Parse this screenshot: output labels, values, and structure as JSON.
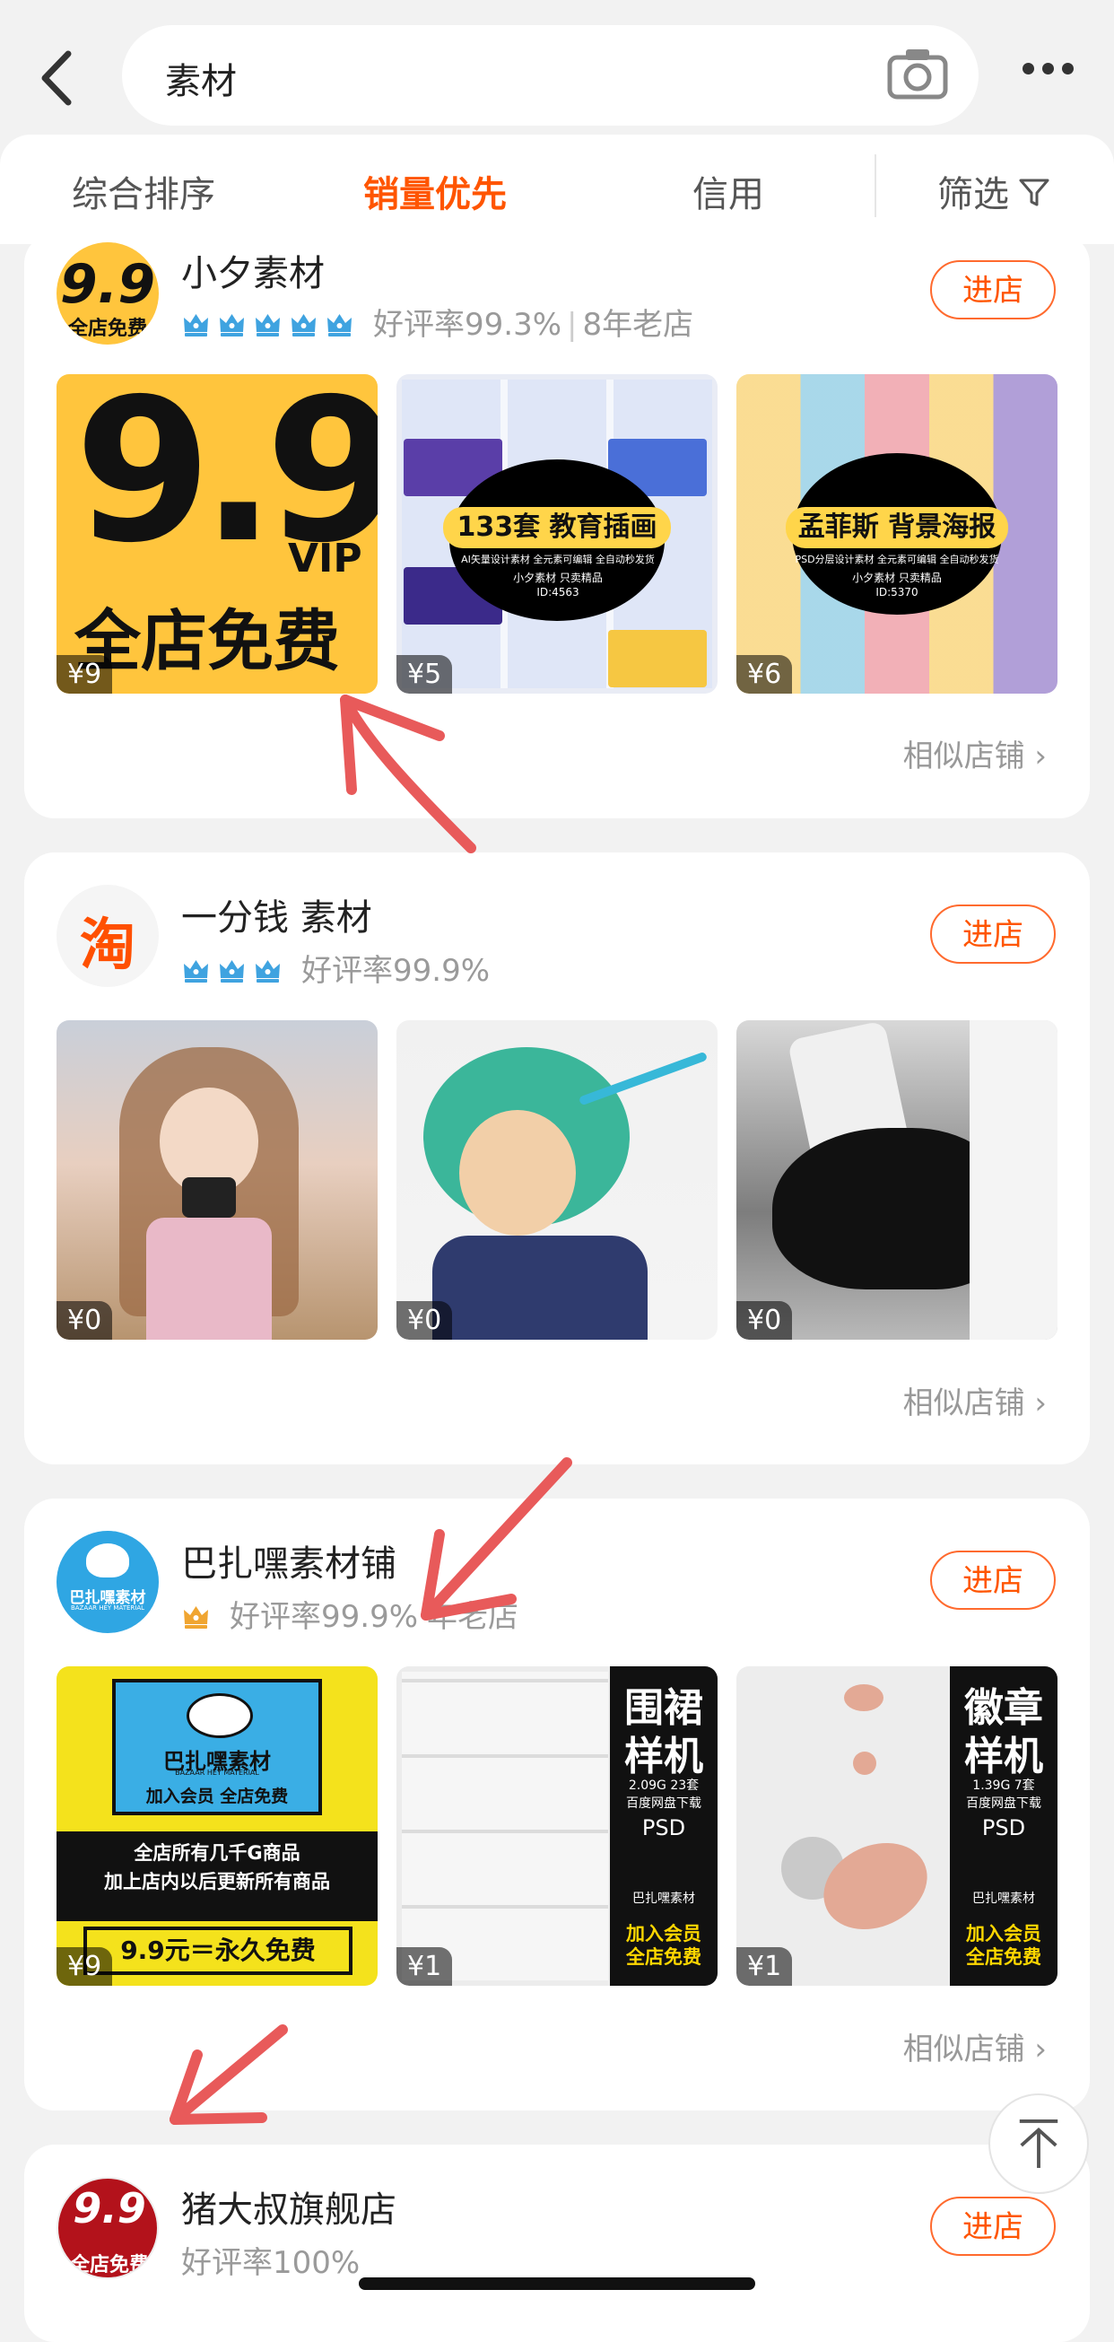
{
  "search": {
    "query": "素材"
  },
  "sort_tabs": [
    "综合排序",
    "销量优先",
    "信用",
    "筛选"
  ],
  "active_tab": "销量优先",
  "colors": {
    "accent": "#ff5500",
    "arrow": "#e85a5a",
    "crown": "#3fa3e0"
  },
  "shops": [
    {
      "name": "小夕素材",
      "rating": "好评率99.3%",
      "extra": "8年老店",
      "crowns": 5,
      "enter": "进店",
      "similar": "相似店铺",
      "logo_text": "9.9",
      "logo_sub": "全店免费",
      "products": [
        {
          "price": "¥9",
          "title": "9.9",
          "tag": "VIP",
          "subtitle": "全店免费"
        },
        {
          "price": "¥5",
          "title": "133套 教育插画",
          "subtitle": "AI矢量设计素材  全元素可编辑 全自动秒发货",
          "footer": "小夕素材 只卖精品",
          "id": "ID:4563"
        },
        {
          "price": "¥6",
          "title": "孟菲斯 背景海报",
          "subtitle": "PSD分层设计素材  全元素可编辑 全自动秒发货",
          "footer": "小夕素材 只卖精品",
          "id": "ID:5370"
        }
      ]
    },
    {
      "name": "一分钱 素材",
      "rating": "好评率99.9%",
      "crowns": 3,
      "enter": "进店",
      "similar": "相似店铺",
      "logo_text": "淘",
      "products": [
        {
          "price": "¥0"
        },
        {
          "price": "¥0"
        },
        {
          "price": "¥0"
        }
      ]
    },
    {
      "name": "巴扎嘿素材铺",
      "rating": "好评率99.9%",
      "extra": "年老店",
      "crowns": 1,
      "enter": "进店",
      "similar": "相似店铺",
      "logo_text": "巴扎嘿素材",
      "logo_sub": "BAZAAR HEY MATERIAL",
      "products": [
        {
          "price": "¥9",
          "brand": "巴扎嘿素材",
          "brand_en": "BAZAAR HEY MATERIAL",
          "member": "加入会员  全店免费",
          "line1": "全店所有几千G商品",
          "line2": "加上店内以后更新所有商品",
          "offer": "9.9元＝永久免费"
        },
        {
          "price": "¥1",
          "title1": "围裙",
          "title2": "样机",
          "size": "2.09G  23套",
          "note": "百度网盘下载",
          "fmt": "PSD",
          "brand": "巴扎嘿素材",
          "cta1": "加入会员",
          "cta2": "全店免费"
        },
        {
          "price": "¥1",
          "title1": "徽章",
          "title2": "样机",
          "size": "1.39G  7套",
          "note": "百度网盘下载",
          "fmt": "PSD",
          "brand": "巴扎嘿素材",
          "cta1": "加入会员",
          "cta2": "全店免费"
        }
      ]
    },
    {
      "name": "猪大叔旗舰店",
      "rating": "好评率100%",
      "enter": "进店",
      "logo_text": "9.9",
      "logo_sub": "全店免费"
    }
  ]
}
